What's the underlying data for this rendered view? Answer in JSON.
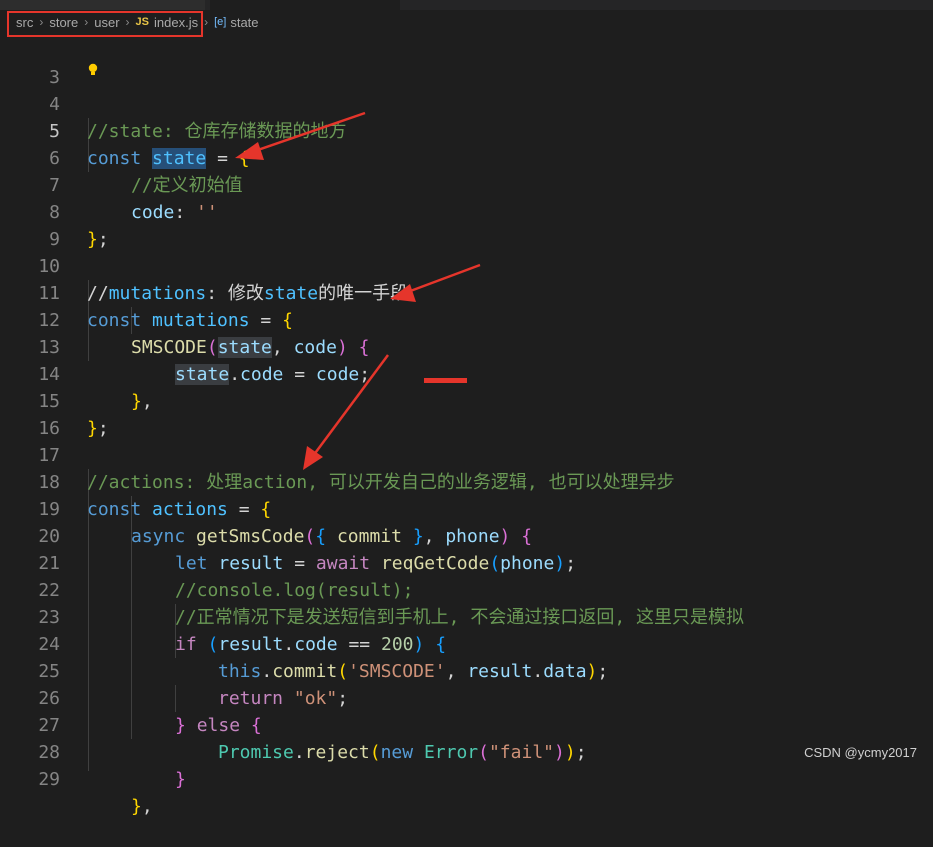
{
  "breadcrumb": {
    "items": [
      "src",
      "store",
      "user",
      "index.js",
      "state"
    ],
    "file_badge": "JS",
    "symbol_badge": "[e]"
  },
  "editor": {
    "lines": [
      {
        "n": "3"
      },
      {
        "n": "4",
        "text": "//state: 仓库存储数据的地方"
      },
      {
        "n": "5",
        "text": "const state = {"
      },
      {
        "n": "6",
        "text": "//定义初始值"
      },
      {
        "n": "7",
        "text": "code: ''"
      },
      {
        "n": "8",
        "text": "};"
      },
      {
        "n": "9"
      },
      {
        "n": "10",
        "text": "//mutations: 修改state的唯一手段"
      },
      {
        "n": "11",
        "text": "const mutations = {"
      },
      {
        "n": "12",
        "text": "SMSCODE(state, code) {"
      },
      {
        "n": "13",
        "text": "state.code = code;"
      },
      {
        "n": "14",
        "text": "},"
      },
      {
        "n": "15",
        "text": "};"
      },
      {
        "n": "16"
      },
      {
        "n": "17",
        "text": "//actions: 处理action, 可以开发自己的业务逻辑, 也可以处理异步"
      },
      {
        "n": "18",
        "text": "const actions = {"
      },
      {
        "n": "19",
        "text": "async getSmsCode({ commit }, phone) {"
      },
      {
        "n": "20",
        "text": "let result = await reqGetCode(phone);"
      },
      {
        "n": "21",
        "text": "//console.log(result);"
      },
      {
        "n": "22",
        "text": "//正常情况下是发送短信到手机上, 不会通过接口返回, 这里只是模拟"
      },
      {
        "n": "23",
        "text": "if (result.code == 200) {"
      },
      {
        "n": "24",
        "text": "this.commit('SMSCODE', result.data);"
      },
      {
        "n": "25",
        "text": "return \"ok\";"
      },
      {
        "n": "26",
        "text": "} else {"
      },
      {
        "n": "27",
        "text": "Promise.reject(new Error(\"fail\"));"
      },
      {
        "n": "28",
        "text": "}"
      },
      {
        "n": "29",
        "text": "},"
      }
    ]
  },
  "watermark": "CSDN @ycmy2017",
  "colors": {
    "background": "#1e1e1e",
    "annotation_red": "#e5352b",
    "keyword": "#569cd6",
    "comment": "#6a9955",
    "string": "#ce9178",
    "function": "#dcdcaa",
    "control": "#c586c0"
  }
}
